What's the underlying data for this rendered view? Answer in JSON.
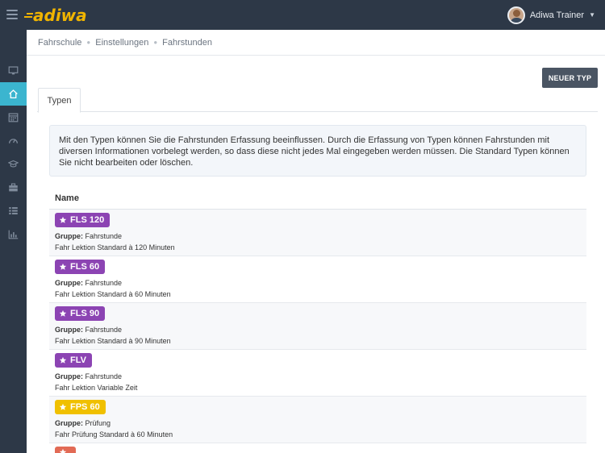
{
  "app": {
    "logo_text": "adiwa"
  },
  "user": {
    "name": "Adiwa Trainer"
  },
  "sidebar": {
    "items": [
      {
        "icon": "monitor-icon"
      },
      {
        "icon": "home-icon",
        "active": true
      },
      {
        "icon": "calendar-icon"
      },
      {
        "icon": "dashboard-icon"
      },
      {
        "icon": "graduation-cap-icon"
      },
      {
        "icon": "briefcase-icon"
      },
      {
        "icon": "list-icon"
      },
      {
        "icon": "bar-chart-icon"
      }
    ]
  },
  "breadcrumb": [
    "Fahrschule",
    "Einstellungen",
    "Fahrstunden"
  ],
  "actions": {
    "new_type": "NEUER TYP"
  },
  "tabs": [
    {
      "label": "Typen"
    }
  ],
  "info": "Mit den Typen können Sie die Fahrstunden Erfassung beeinflussen. Durch die Erfassung von Typen können Fahrstunden mit diversen Informationen vorbelegt werden, so dass diese nicht jedes Mal eingegeben werden müssen. Die Standard Typen können Sie nicht bearbeiten oder löschen.",
  "table": {
    "header": "Name",
    "group_label": "Gruppe:",
    "rows": [
      {
        "badge": "FLS 120",
        "color": "#8c44b3",
        "group": "Fahrstunde",
        "description": "Fahr Lektion Standard à 120 Minuten"
      },
      {
        "badge": "FLS 60",
        "color": "#8c44b3",
        "group": "Fahrstunde",
        "description": "Fahr Lektion Standard à 60 Minuten"
      },
      {
        "badge": "FLS 90",
        "color": "#8c44b3",
        "group": "Fahrstunde",
        "description": "Fahr Lektion Standard à 90 Minuten"
      },
      {
        "badge": "FLV",
        "color": "#8c44b3",
        "group": "Fahrstunde",
        "description": "Fahr Lektion Variable Zeit"
      },
      {
        "badge": "FPS 60",
        "color": "#f0c000",
        "group": "Prüfung",
        "description": "Fahr Prüfung Standard à 60 Minuten"
      }
    ]
  },
  "colors": {
    "topbar": "#2d3847",
    "sidebar_active": "#3bb5cf",
    "logo": "#f0b400"
  }
}
